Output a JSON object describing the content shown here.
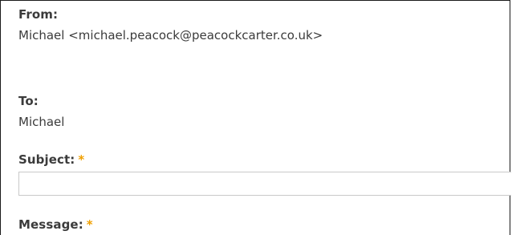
{
  "form": {
    "from": {
      "label": "From:",
      "value": "Michael <michael.peacock@peacockcarter.co.uk>"
    },
    "to": {
      "label": "To:",
      "value": "Michael"
    },
    "subject": {
      "label": "Subject:",
      "required_marker": "*",
      "value": "",
      "placeholder": ""
    },
    "message": {
      "label": "Message:",
      "required_marker": "*"
    }
  },
  "colors": {
    "text": "#3b3b3b",
    "required": "#f0a000",
    "input_border": "#c9c9c9",
    "frame_border": "#1a1a1a"
  }
}
